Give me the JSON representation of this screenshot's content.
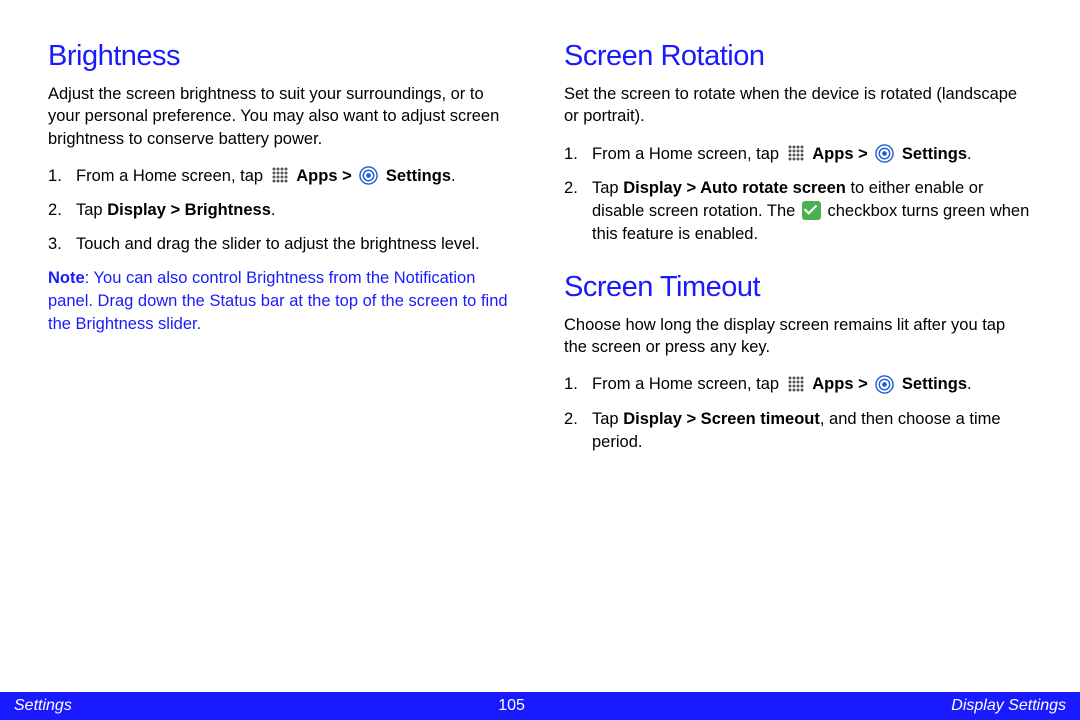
{
  "leftColumn": {
    "brightness": {
      "heading": "Brightness",
      "intro": "Adjust the screen brightness to suit your surroundings, or to your personal preference. You may also want to adjust screen brightness to conserve battery power.",
      "step1_prefix": "From a Home screen, tap ",
      "step1_apps": "Apps > ",
      "step1_settings": "Settings",
      "step1_suffix": ".",
      "step2_prefix": "Tap ",
      "step2_bold": "Display > Brightness",
      "step2_suffix": ".",
      "step3": "Touch and drag the slider to adjust the brightness level.",
      "note_label": "Note",
      "note_text": ": You can also control Brightness from the Notification panel. Drag down the Status bar at the top of the screen to find the Brightness slider."
    }
  },
  "rightColumn": {
    "rotation": {
      "heading": "Screen Rotation",
      "intro": "Set the screen to rotate when the device is rotated (landscape or portrait).",
      "step1_prefix": "From a Home screen, tap ",
      "step1_apps": "Apps > ",
      "step1_settings": "Settings",
      "step1_suffix": ".",
      "step2_prefix": "Tap ",
      "step2_bold": "Display > Auto rotate screen",
      "step2_mid": " to either enable or disable screen rotation. The ",
      "step2_suffix": " checkbox turns green when this feature is enabled."
    },
    "timeout": {
      "heading": "Screen Timeout",
      "intro": "Choose how long the display screen remains lit after you tap the screen or press any key.",
      "step1_prefix": "From a Home screen, tap ",
      "step1_apps": "Apps > ",
      "step1_settings": "Settings",
      "step1_suffix": ".",
      "step2_prefix": "Tap ",
      "step2_bold": "Display > Screen timeout",
      "step2_suffix": ", and then choose a time period."
    }
  },
  "footer": {
    "left": "Settings",
    "center": "105",
    "right": "Display Settings"
  }
}
